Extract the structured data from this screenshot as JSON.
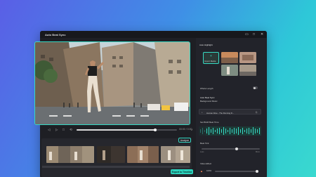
{
  "window": {
    "title": "Auto Beat Sync",
    "controls": {
      "restore": "▭",
      "maximize": "□",
      "close": "✕"
    }
  },
  "player": {
    "controls": {
      "rewind": "◁",
      "play": "▷",
      "stop": "□",
      "loop": "⟲",
      "volume": "♪"
    },
    "progress": 0.78,
    "timecode": "00:00 / 0:00"
  },
  "timeline": {
    "analyze_label": "Analyze"
  },
  "right_panel": {
    "section_title": "Auto Highlight",
    "import_label": "Import Media",
    "whole_length_label": "Whole Length",
    "auto_beat_section": "Auto Beat Sync",
    "background_music_label": "Background Music",
    "music_name": "Human Alive - The Running D...",
    "set_beat_label": "Set BGM Beat Time",
    "beat_level_label": "Beat Tick",
    "beat_range": {
      "min": "Less",
      "max": "More"
    },
    "video_effect_label": "Video Effect",
    "volume_value": "100%",
    "export_label": "Export to Timeline"
  },
  "colors": {
    "accent": "#36d9c4",
    "window_bg": "#1e1f24",
    "panel_bg": "#22232a"
  }
}
